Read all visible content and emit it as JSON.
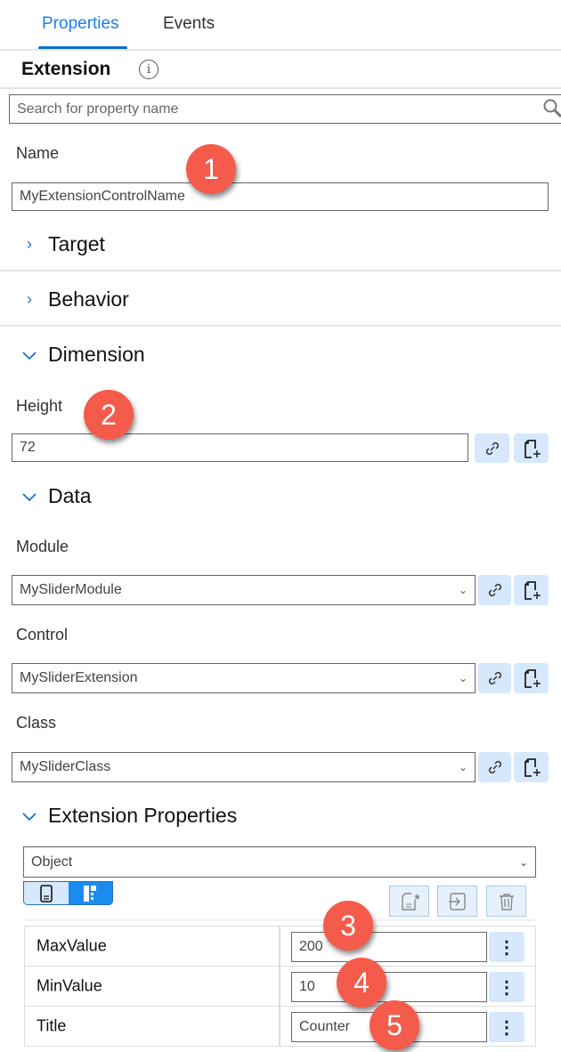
{
  "tabs": [
    {
      "label": "Properties",
      "active": true
    },
    {
      "label": "Events",
      "active": false
    }
  ],
  "header": {
    "title": "Extension",
    "info_icon": "info-icon"
  },
  "search": {
    "placeholder": "Search for property name",
    "icon": "search-icon"
  },
  "name": {
    "label": "Name",
    "value": "MyExtensionControlName"
  },
  "sections": {
    "target": "Target",
    "behavior": "Behavior",
    "dimension": "Dimension",
    "data": "Data",
    "extension_properties": "Extension Properties"
  },
  "dimension": {
    "height_label": "Height",
    "height_value": "72"
  },
  "data": {
    "module_label": "Module",
    "module_value": "MySliderModule",
    "control_label": "Control",
    "control_value": "MySliderExtension",
    "class_label": "Class",
    "class_value": "MySliderClass"
  },
  "extension_properties": {
    "type_value": "Object",
    "rows": [
      {
        "name": "MaxValue",
        "value": "200"
      },
      {
        "name": "MinValue",
        "value": "10"
      },
      {
        "name": "Title",
        "value": "Counter"
      }
    ]
  },
  "badges": [
    "1",
    "2",
    "3",
    "4",
    "5"
  ],
  "colors": {
    "accent": "#1a7ff0",
    "badge": "#f45b4b",
    "button_bg": "#d6e8fb"
  }
}
